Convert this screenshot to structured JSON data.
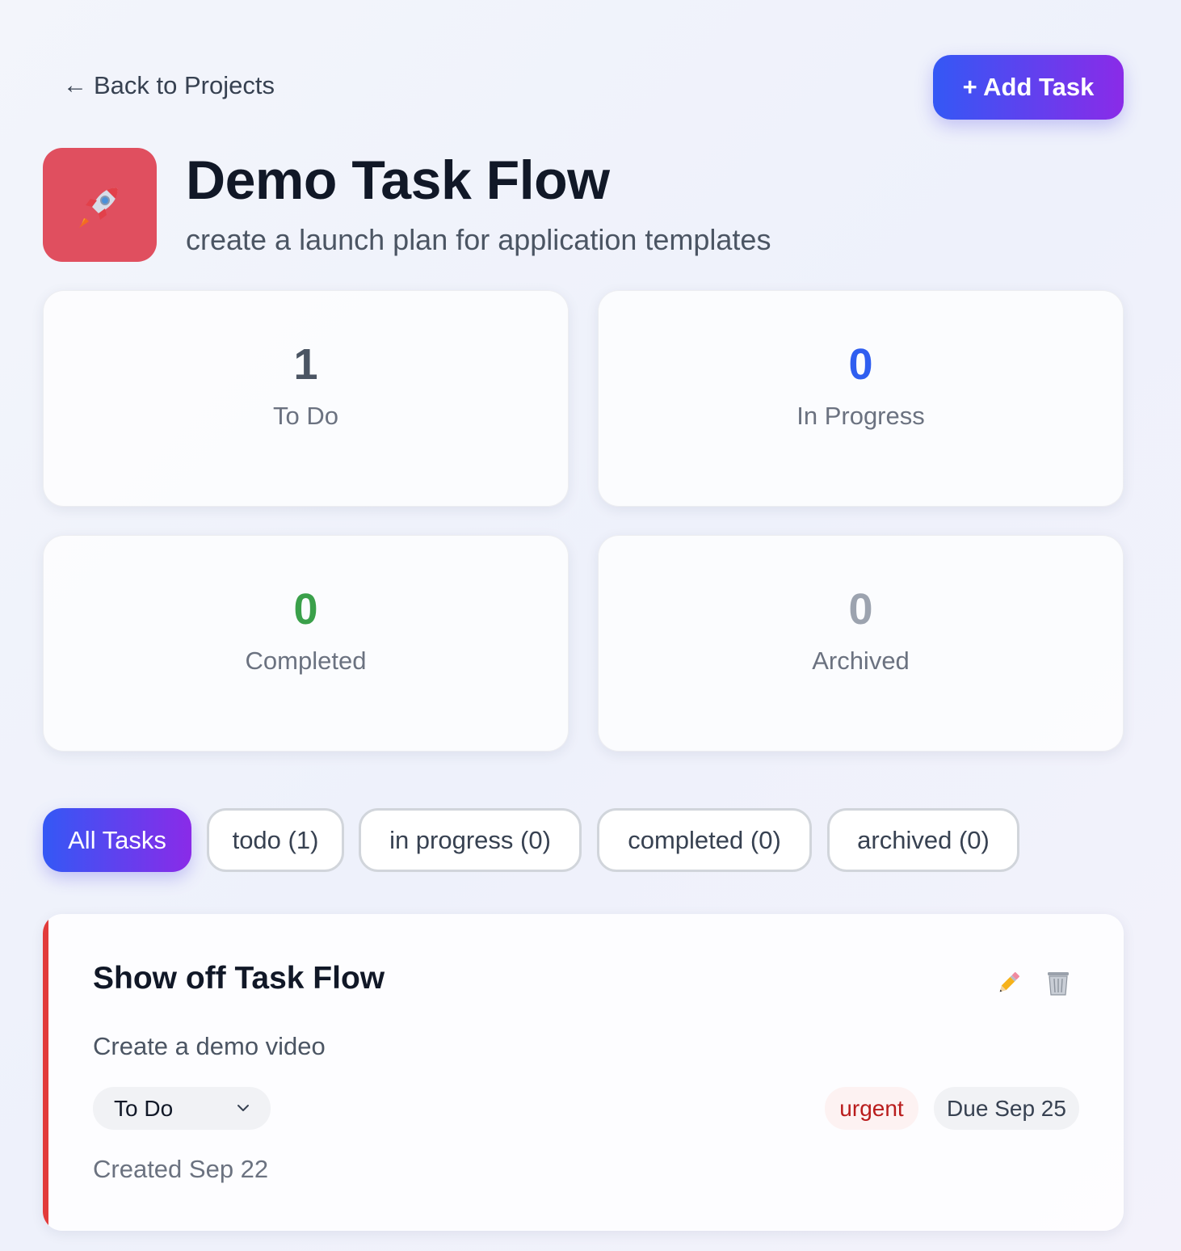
{
  "nav": {
    "back_arrow": "←",
    "back_label": "Back to Projects"
  },
  "header": {
    "add_task_label": "+ Add Task"
  },
  "project": {
    "icon": "rocket-icon",
    "icon_color": "#e04f5f",
    "title": "Demo Task Flow",
    "subtitle": "create a launch plan for application templates"
  },
  "stats": [
    {
      "value": "1",
      "label": "To Do",
      "color": "#4b5563"
    },
    {
      "value": "0",
      "label": "In Progress",
      "color": "#2f5ef0"
    },
    {
      "value": "0",
      "label": "Completed",
      "color": "#3aa04a"
    },
    {
      "value": "0",
      "label": "Archived",
      "color": "#9ca3af"
    }
  ],
  "filters": [
    {
      "label": "All Tasks",
      "active": true
    },
    {
      "label": "todo (1)",
      "active": false
    },
    {
      "label": "in progress (0)",
      "active": false
    },
    {
      "label": "completed (0)",
      "active": false
    },
    {
      "label": "archived (0)",
      "active": false
    }
  ],
  "tasks": [
    {
      "title": "Show off Task Flow",
      "description": "Create a demo video",
      "status": "To Do",
      "priority": "urgent",
      "priority_color": "#e23b3b",
      "due": "Due Sep 25",
      "created": "Created Sep 22",
      "actions": [
        "pencil-icon",
        "trash-icon"
      ]
    }
  ],
  "colors": {
    "accent_start": "#3458f5",
    "accent_end": "#8a2be8"
  }
}
